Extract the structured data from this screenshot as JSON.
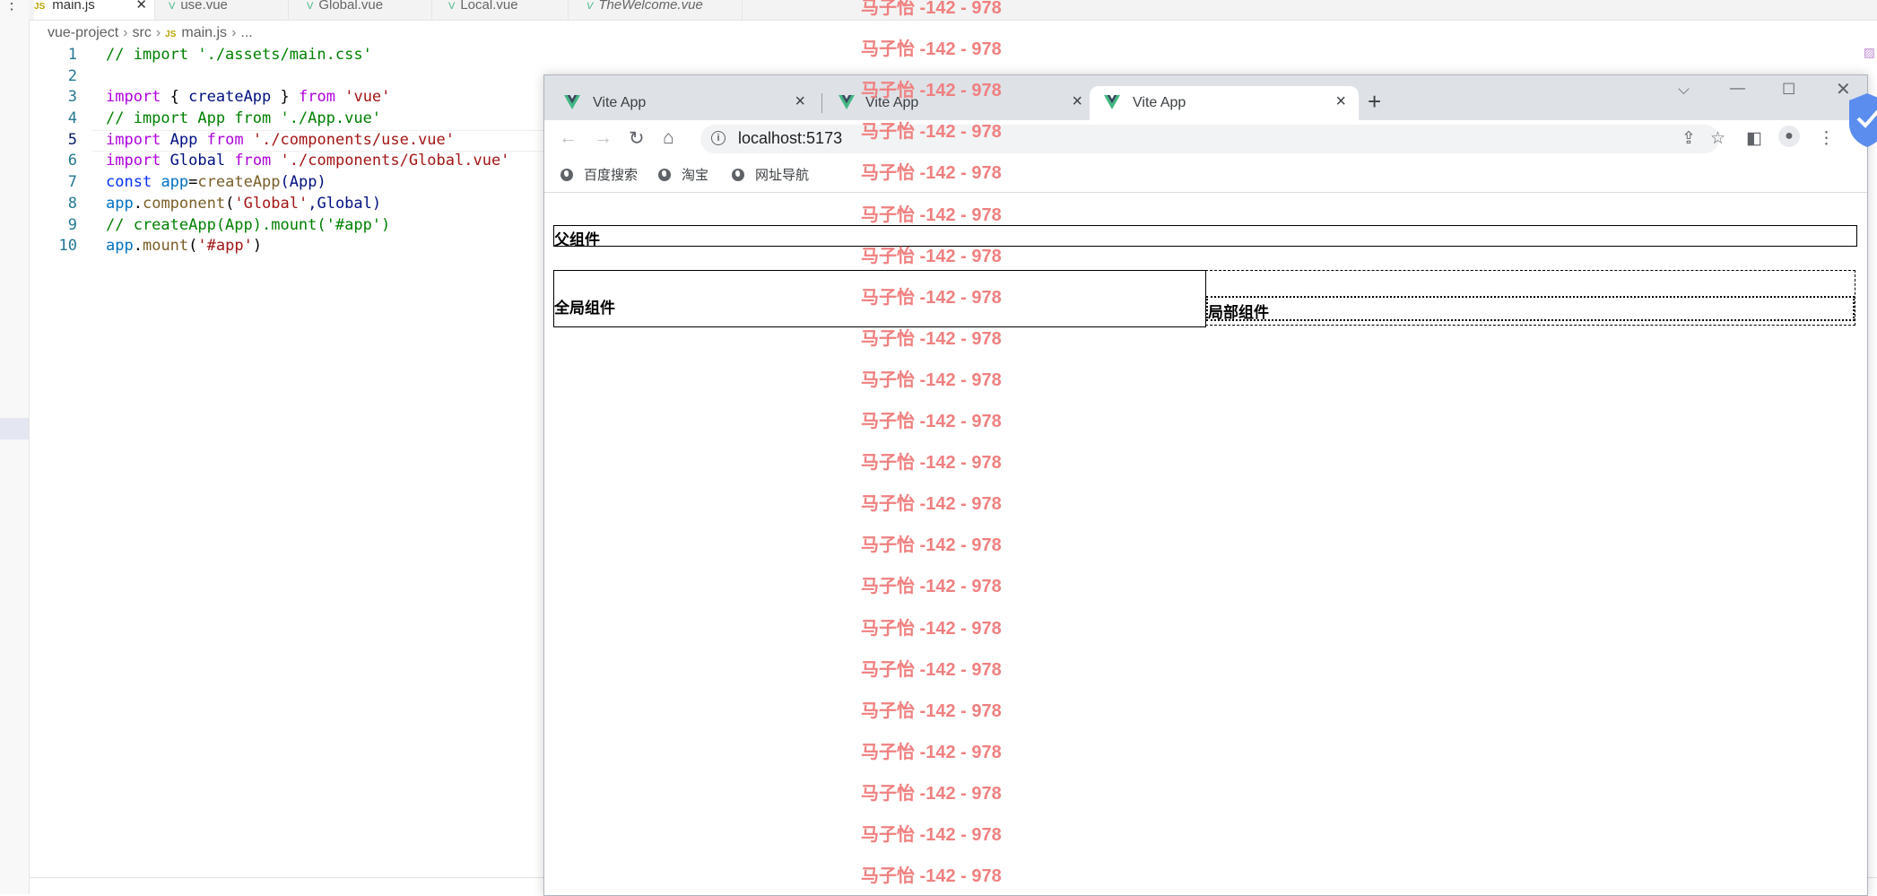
{
  "editor": {
    "tabs": [
      {
        "icon": "JS",
        "label": "main.js",
        "active": true
      },
      {
        "icon": "V",
        "label": "use.vue"
      },
      {
        "icon": "V",
        "label": "Global.vue"
      },
      {
        "icon": "V",
        "label": "Local.vue"
      },
      {
        "icon": "V",
        "label": "TheWelcome.vue"
      }
    ],
    "breadcrumb": {
      "root": "vue-project",
      "folder": "src",
      "file_icon": "JS",
      "file": "main.js",
      "more": "..."
    },
    "code_lines": [
      {
        "n": "1"
      },
      {
        "n": "2"
      },
      {
        "n": "3"
      },
      {
        "n": "4"
      },
      {
        "n": "5"
      },
      {
        "n": "6"
      },
      {
        "n": "7"
      },
      {
        "n": "8"
      },
      {
        "n": "9"
      },
      {
        "n": "10"
      }
    ],
    "code": {
      "l1_comment": "// import './assets/main.css'",
      "l3_import": "import",
      "l3_brace_open": "{ ",
      "l3_name": "createApp",
      "l3_brace_close": " }",
      "l3_from": "from",
      "l3_src": "'vue'",
      "l4_comment": "// import App from './App.vue'",
      "l5_import": "import",
      "l5_name": "App",
      "l5_from": "from",
      "l5_src": "'./components/use.vue'",
      "l6_import": "import",
      "l6_name": "Global",
      "l6_from": "from",
      "l6_src": "'./components/Global.vue'",
      "l7_const": "const",
      "l7_var": "app",
      "l7_eq": "=",
      "l7_fn": "createApp",
      "l7_arg": "(App)",
      "l8_obj": "app",
      "l8_dot": ".",
      "l8_fn": "component",
      "l8_open": "(",
      "l8_str": "'Global'",
      "l8_rest": ",Global)",
      "l9_comment": "// createApp(App).mount('#app')",
      "l10_obj": "app",
      "l10_dot": ".",
      "l10_fn": "mount",
      "l10_open": "(",
      "l10_str": "'#app'",
      "l10_close": ")"
    }
  },
  "browser": {
    "tabs": [
      {
        "title": "Vite App",
        "active": false
      },
      {
        "title": "Vite App",
        "active": false
      },
      {
        "title": "Vite App",
        "active": true
      }
    ],
    "new_tab": "+",
    "url": "localhost:5173",
    "bookmarks": [
      "百度搜索",
      "淘宝",
      "网址导航"
    ],
    "page": {
      "parent_title": "父组件",
      "global_title": "全局组件",
      "local_title": "局部组件"
    }
  },
  "watermark": {
    "text": "马子怡 -142 - 978",
    "color": "#f08080"
  },
  "colors": {
    "vue_green": "#41b883",
    "vue_dark": "#35495e",
    "chrome_strip": "#dee1e6"
  }
}
